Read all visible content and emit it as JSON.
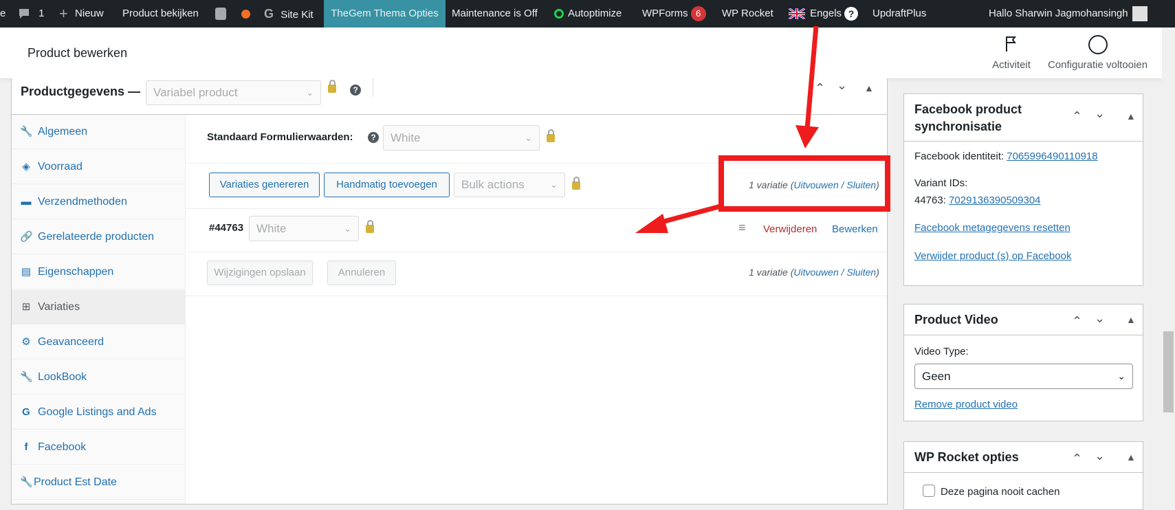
{
  "adminbar": {
    "comments_count": "1",
    "new_label": "Nieuw",
    "view_product": "Product bekijken",
    "site_kit": "Site Kit",
    "thegem": "TheGem Thema Opties",
    "maintenance": "Maintenance is Off",
    "autoptimize": "Autoptimize",
    "wpforms": "WPForms",
    "wpforms_count": "6",
    "wprocket": "WP Rocket",
    "language": "Engels",
    "updraftplus": "UpdraftPlus",
    "greeting": "Hallo Sharwin Jagmohansingh"
  },
  "header": {
    "title": "Product bewerken",
    "activity_label": "Activiteit",
    "setup_label": "Configuratie voltooien"
  },
  "product_data": {
    "title": "Productgegevens —",
    "type_select": "Variabel product",
    "tabs": [
      {
        "label": "Algemeen",
        "icon": "wrench-icon"
      },
      {
        "label": "Voorraad",
        "icon": "tag-icon"
      },
      {
        "label": "Verzendmethoden",
        "icon": "truck-icon"
      },
      {
        "label": "Gerelateerde producten",
        "icon": "link-icon"
      },
      {
        "label": "Eigenschappen",
        "icon": "list-icon"
      },
      {
        "label": "Variaties",
        "icon": "grid-icon"
      },
      {
        "label": "Geavanceerd",
        "icon": "gear-icon"
      },
      {
        "label": "LookBook",
        "icon": "wrench-icon"
      },
      {
        "label": "Google Listings and Ads",
        "icon": "google-icon"
      },
      {
        "label": "Facebook",
        "icon": "facebook-icon"
      },
      {
        "label": "Product Est Date",
        "icon": "wrench-icon"
      }
    ],
    "default_form_label": "Standaard Formulierwaarden:",
    "default_form_value": "White",
    "generate_button": "Variaties genereren",
    "add_manual_button": "Handmatig toevoegen",
    "bulk_actions": "Bulk actions",
    "variation_count_prefix": "1 variatie (",
    "expand_label": "Uitvouwen",
    "separator": " / ",
    "close_label": "Sluiten",
    "variation_count_suffix": ")",
    "variation_id": "#44763",
    "variation_value": "White",
    "remove_label": "Verwijderen",
    "edit_label": "Bewerken",
    "save_button": "Wijzigingen opslaan",
    "cancel_button": "Annuleren"
  },
  "facebook_box": {
    "title": "Facebook product synchronisatie",
    "identity_label": "Facebook identiteit: ",
    "identity_value": "7065996490110918",
    "variant_label": "Variant IDs:",
    "variant_key": "44763: ",
    "variant_value": "7029136390509304",
    "reset_link": "Facebook metagegevens resetten",
    "delete_link": "Verwijder product (s) op Facebook"
  },
  "video_box": {
    "title": "Product Video",
    "type_label": "Video Type:",
    "type_value": "Geen",
    "remove_link": "Remove product video"
  },
  "rocket_box": {
    "title": "WP Rocket opties",
    "never_cache_label": "Deze pagina nooit cachen"
  },
  "colors": {
    "adminbar_bg": "#1d2327",
    "highlight": "#3892a3",
    "link": "#2271b1",
    "delete": "#b32d2e",
    "annotation": "#ee1c1c"
  }
}
